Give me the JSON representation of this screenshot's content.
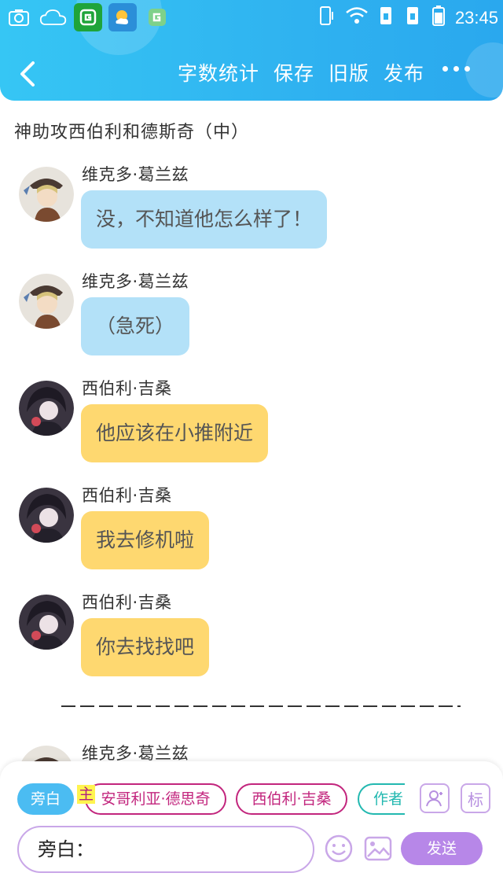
{
  "status_bar": {
    "time": "23:45"
  },
  "nav": {
    "actions": [
      "字数统计",
      "保存",
      "旧版",
      "发布"
    ]
  },
  "document": {
    "title": "神助攻西伯利和德斯奇（中）"
  },
  "messages": [
    {
      "speaker": "维克多·葛兰兹",
      "text": "没，不知道他怎么样了！",
      "color": "blue"
    },
    {
      "speaker": "维克多·葛兰兹",
      "text": "（急死）",
      "color": "blue"
    },
    {
      "speaker": "西伯利·吉桑",
      "text": "他应该在小推附近",
      "color": "yellow"
    },
    {
      "speaker": "西伯利·吉桑",
      "text": "我去修机啦",
      "color": "yellow"
    },
    {
      "speaker": "西伯利·吉桑",
      "text": "你去找找吧",
      "color": "yellow"
    },
    {
      "speaker": "维克多·葛兰兹"
    }
  ],
  "composer": {
    "chips": {
      "narration": "旁白",
      "main_tag": "主",
      "role_a": "安哥利亚·德思奇",
      "role_b": "西伯利·吉桑",
      "role_c": "作者"
    },
    "tool_mark": "标",
    "input_value": "旁白：",
    "send_label": "发送"
  },
  "colors": {
    "header": "#2fb2f0",
    "bubble_blue": "#b3e1f8",
    "bubble_yellow": "#fed870",
    "send": "#b787e8",
    "role_chip": "#c2257d",
    "author_chip": "#22b8b0"
  }
}
